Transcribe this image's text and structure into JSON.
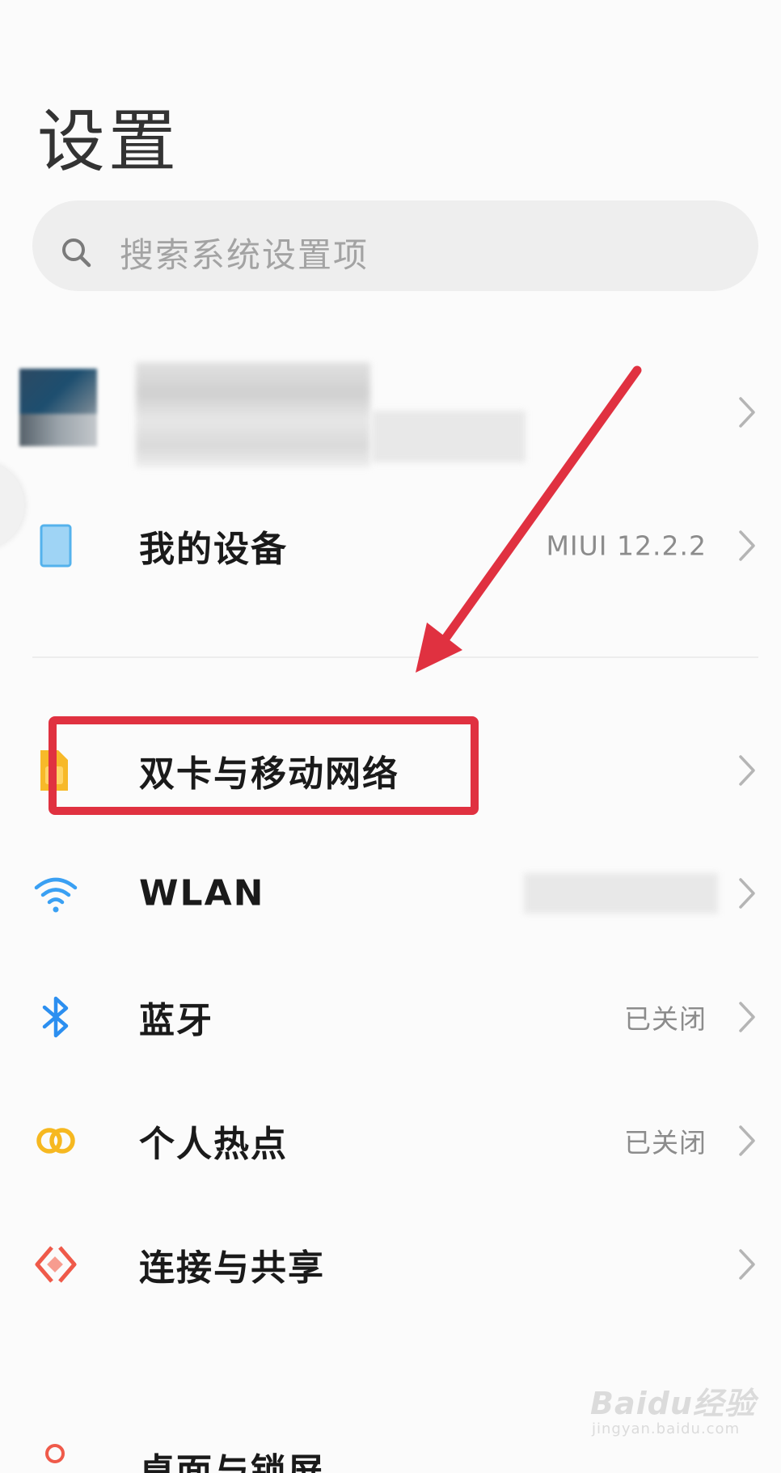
{
  "header": {
    "title": "设置"
  },
  "search": {
    "placeholder": "搜索系统设置项"
  },
  "account": {
    "name": "",
    "subtitle": ""
  },
  "rows": [
    {
      "id": "my-device",
      "label": "我的设备",
      "value": "MIUI 12.2.2",
      "icon": "tablet-icon"
    },
    {
      "id": "dual-sim",
      "label": "双卡与移动网络",
      "value": "",
      "icon": "sim-card-icon"
    },
    {
      "id": "wlan",
      "label": "WLAN",
      "value": "",
      "icon": "wifi-icon"
    },
    {
      "id": "bluetooth",
      "label": "蓝牙",
      "value": "已关闭",
      "icon": "bluetooth-icon"
    },
    {
      "id": "hotspot",
      "label": "个人热点",
      "value": "已关闭",
      "icon": "hotspot-icon"
    },
    {
      "id": "connection",
      "label": "连接与共享",
      "value": "",
      "icon": "share-icon"
    }
  ],
  "partial_row": {
    "label": "桌面与锁屏"
  },
  "watermark": {
    "logo": "Baidu经验",
    "site": "jingyan.baidu.com"
  },
  "colors": {
    "annotation_red": "#e03140",
    "wifi_blue": "#3aa0f3",
    "bluetooth_blue": "#2c8ff0",
    "hotspot_yellow": "#f6b820",
    "share_red": "#ef5a4a",
    "sim_yellow": "#f7b929"
  }
}
